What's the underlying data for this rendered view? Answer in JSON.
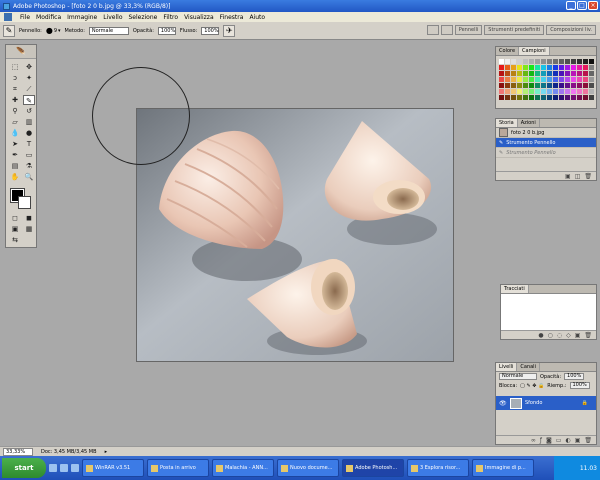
{
  "window": {
    "title": "Adobe Photoshop - [foto 2 0 b.jpg @ 33,3% (RGB/8)]"
  },
  "menu": [
    "File",
    "Modifica",
    "Immagine",
    "Livello",
    "Selezione",
    "Filtro",
    "Visualizza",
    "Finestra",
    "Aiuto"
  ],
  "options": {
    "brush_label": "Pennello:",
    "brush_size": "9",
    "mode_label": "Metodo:",
    "mode_value": "Normale",
    "opacity_label": "Opacità:",
    "opacity_value": "100%",
    "flow_label": "Flusso:",
    "flow_value": "100%",
    "right_tabs": [
      "Pennelli",
      "Strumenti predefiniti",
      "Composizioni liv."
    ]
  },
  "panels": {
    "color": {
      "tabs": [
        "Colore",
        "Campioni"
      ],
      "active": "Campioni"
    },
    "history": {
      "tabs": [
        "Storia",
        "Azioni"
      ],
      "snapshot": "foto 2 0 b.jpg",
      "selected_step": "Strumento Pennello",
      "ghost_step": "Strumento Pennello"
    },
    "paths": {
      "tabs": [
        "Tracciati"
      ]
    },
    "layers": {
      "tabs": [
        "Livelli",
        "Canali"
      ],
      "blend_mode": "Normale",
      "opacity_label": "Opacità:",
      "opacity_value": "100%",
      "lock_label": "Blocca:",
      "fill_label": "Riemp.:",
      "fill_value": "100%",
      "layer_name": "Sfondo"
    }
  },
  "status": {
    "zoom": "33,33%",
    "doc": "Doc: 3,45 MB/3,45 MB"
  },
  "taskbar": {
    "start": "start",
    "tasks": [
      "WinRAR v3.51",
      "Posta in arrivo",
      "Malachia - ANN...",
      "Nuovo docume...",
      "Adobe Photosh...",
      "3 Esplora risor...",
      "Immagine di p..."
    ],
    "active_index": 4,
    "clock": "11.03"
  },
  "colors": {
    "accent": "#2a5fc8",
    "chrome": "#d4d0c8",
    "workspace": "#a9a9a9"
  }
}
